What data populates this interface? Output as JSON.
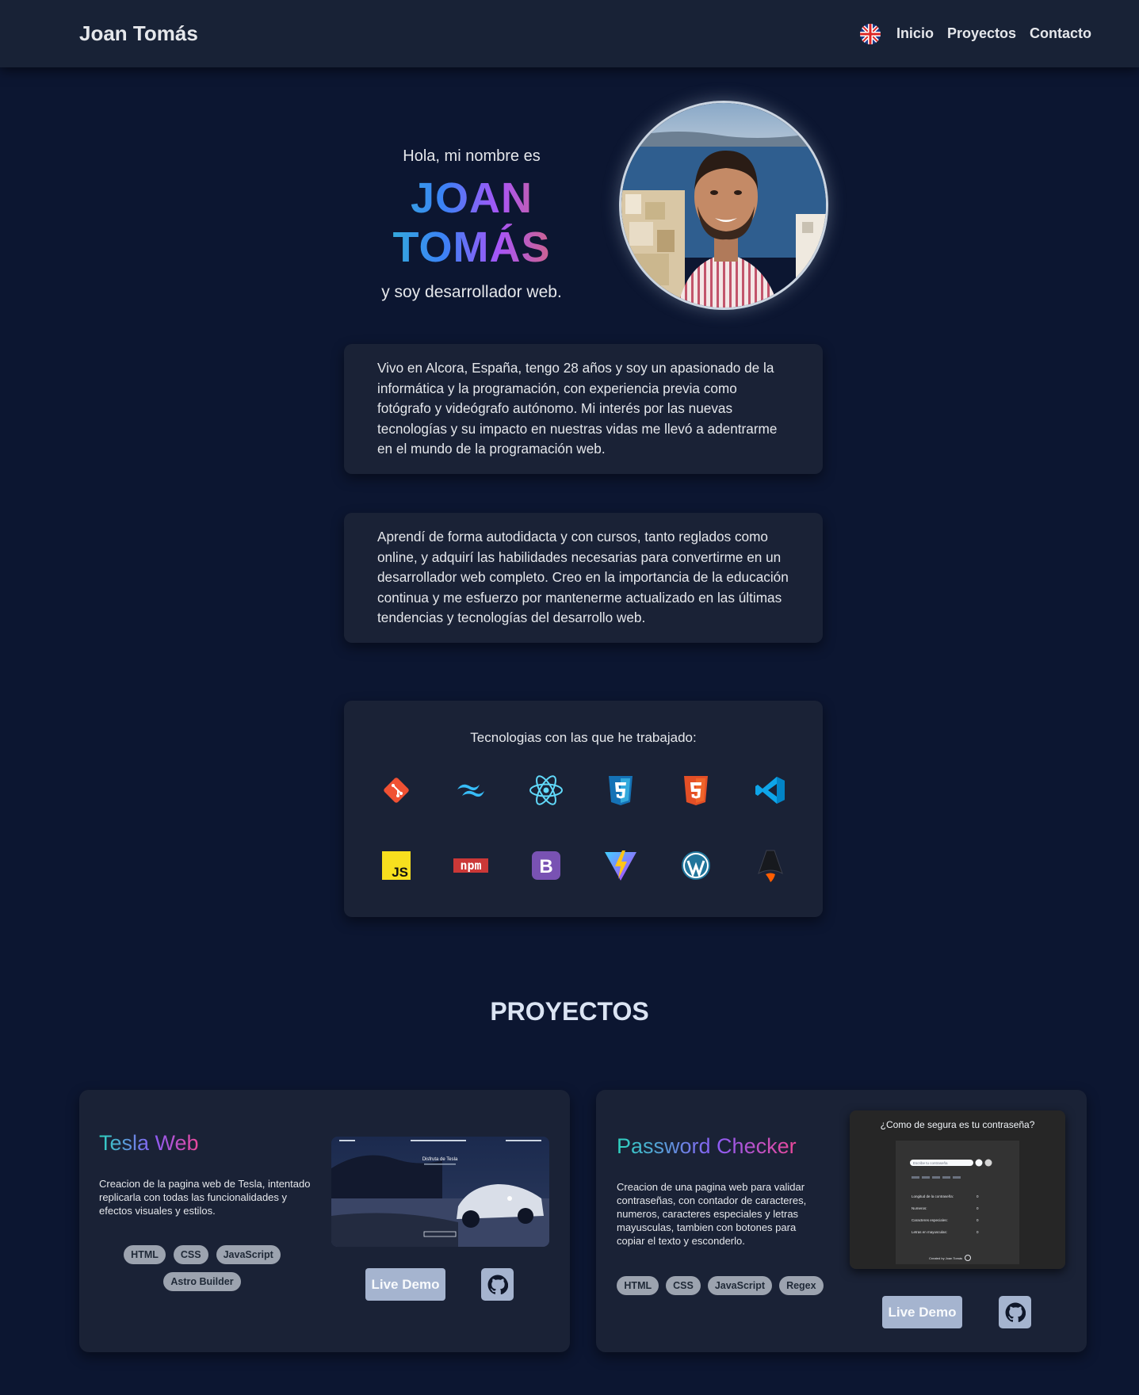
{
  "nav": {
    "brand": "Joan Tomás",
    "links": [
      "Inicio",
      "Proyectos",
      "Contacto"
    ],
    "language_icon": "uk-flag-icon"
  },
  "hero": {
    "greeting": "Hola, mi nombre es",
    "name": "JOAN TOMÁS",
    "tagline": "y soy desarrollador web."
  },
  "about": [
    "Vivo en Alcora, España, tengo 28 años y soy un apasionado de la informática y la programación, con experiencia previa como fotógrafo y videógrafo autónomo. Mi interés por las nuevas tecnologías y su impacto en nuestras vidas me llevó a adentrarme en el mundo de la programación web.",
    "Aprendí de forma autodidacta y con cursos, tanto reglados como online, y adquirí las habilidades necesarias para convertirme en un desarrollador web completo. Creo en la importancia de la educación continua y me esfuerzo por mantenerme actualizado en las últimas tendencias y tecnologías del desarrollo web."
  ],
  "technologies": {
    "title": "Tecnologias con las que he trabajado:",
    "icons": [
      "git-icon",
      "tailwind-icon",
      "react-icon",
      "css3-icon",
      "html5-icon",
      "vscode-icon",
      "javascript-icon",
      "npm-icon",
      "bootstrap-icon",
      "vite-icon",
      "wordpress-icon",
      "astro-icon"
    ],
    "labels": {
      "js": "JS",
      "npm": "npm",
      "bootstrap": "B"
    }
  },
  "projects_section": {
    "title": "PROYECTOS"
  },
  "projects": [
    {
      "title": "Tesla Web",
      "description": "Creacion de la pagina web de Tesla, intentado replicarla con todas las funcionalidades y efectos visuales y estilos.",
      "tags": [
        "HTML",
        "CSS",
        "JavaScript",
        "Astro Builder"
      ],
      "demo_label": "Live Demo",
      "screenshot_heading": "Disfruta de Tesla"
    },
    {
      "title": "Password Checker",
      "description": "Creacion de una pagina web para validar contraseñas, con contador de caracteres, numeros, caracteres especiales y letras mayusculas, tambien con botones para copiar el texto y esconderlo.",
      "tags": [
        "HTML",
        "CSS",
        "JavaScript",
        "Regex"
      ],
      "demo_label": "Live Demo",
      "screenshot_heading": "¿Como de segura es tu contraseña?",
      "screenshot_input_placeholder": "Escribe tu contraseña",
      "screenshot_rows": [
        {
          "label": "Longitud de la contraseña:",
          "value": "0"
        },
        {
          "label": "Numeros:",
          "value": "0"
        },
        {
          "label": "Caracteres especiales:",
          "value": "0"
        },
        {
          "label": "Letras en mayusculas:",
          "value": "0"
        }
      ],
      "screenshot_footer": "Created by Joan Tomás"
    }
  ],
  "colors": {
    "background": "#0c1631",
    "card": "#1a2236",
    "nav": "#182236",
    "button": "#a5b4cf"
  }
}
